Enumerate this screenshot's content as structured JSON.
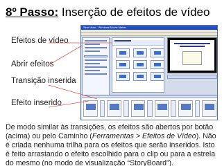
{
  "title": {
    "step": "8º Passo:",
    "text": " Inserção de efeitos de vídeo"
  },
  "callouts": [
    "Efeitos de vídeo",
    "Abrir efeitos",
    "Transição inserida",
    "Efeito inserido"
  ],
  "screenshot": {
    "window_title": "Sem título - Windows Movie Maker"
  },
  "body": {
    "part1": "De modo similar às transições, os efeitos são abertos por botão (acima) ou pelo Caminho (",
    "menu_path": "Ferramentas > Efeitos de Vídeo",
    "part2": "). Não é criada nenhuma trilha para os efeitos que serão inseridos. Isto é feito arrastando o efeito escolhido para o clip ou para a estrela do mesmo (no modo de visualização “StoryBoard”)."
  },
  "colors": {
    "accent": "#2b5bd3",
    "callout_line": "#e05a5a"
  }
}
